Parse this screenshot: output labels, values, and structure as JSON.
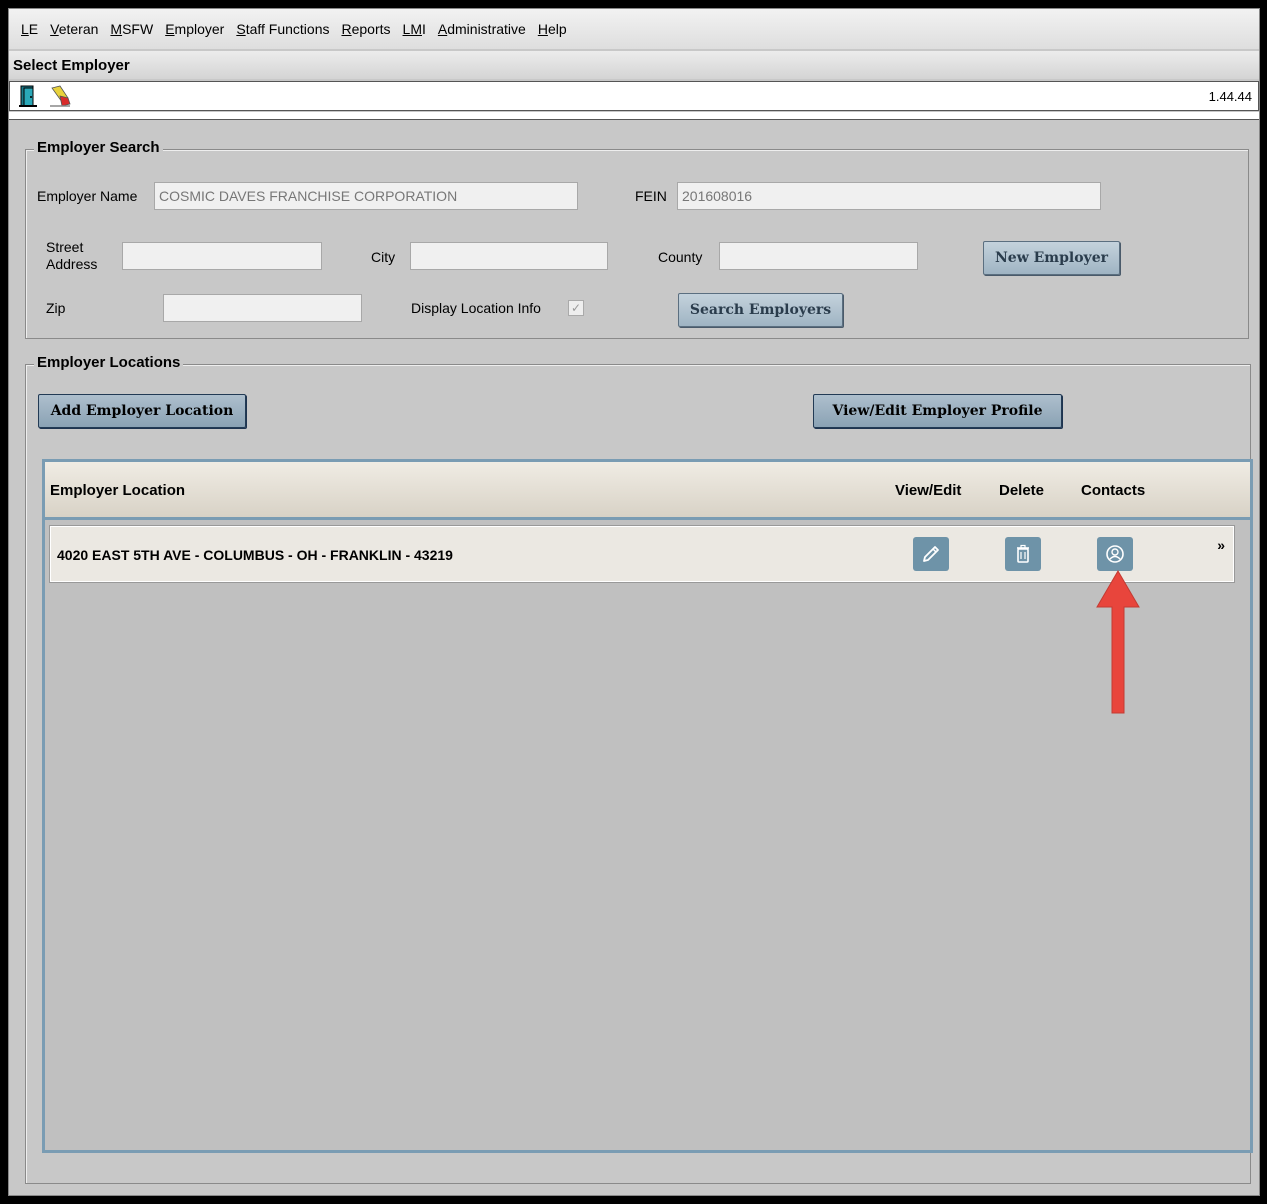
{
  "menu": [
    {
      "ul": "L",
      "rest": "E"
    },
    {
      "ul": "V",
      "rest": "eteran"
    },
    {
      "ul": "M",
      "rest": "SFW"
    },
    {
      "ul": "E",
      "rest": "mployer"
    },
    {
      "ul": "S",
      "rest": "taff Functions"
    },
    {
      "ul": "R",
      "rest": "eports"
    },
    {
      "ul": "LM",
      "rest": "I"
    },
    {
      "ul": "A",
      "rest": "dministrative"
    },
    {
      "ul": "H",
      "rest": "elp"
    }
  ],
  "window": {
    "title": "Select Employer",
    "version": "1.44.44"
  },
  "toolbar": {
    "icons": [
      "exit-door-icon",
      "eraser-clear-icon"
    ]
  },
  "search": {
    "legend": "Employer Search",
    "employer_name_label": "Employer Name",
    "employer_name_value": "COSMIC DAVES FRANCHISE CORPORATION",
    "fein_label": "FEIN",
    "fein_value": "201608016",
    "street_label_1": "Street",
    "street_label_2": "Address",
    "street_value": "",
    "city_label": "City",
    "city_value": "",
    "county_label": "County",
    "county_value": "",
    "zip_label": "Zip",
    "zip_value": "",
    "display_location_label": "Display Location Info",
    "display_location_checked": true,
    "new_employer_label": "New Employer",
    "search_employers_label": "Search Employers"
  },
  "locations": {
    "legend": "Employer Locations",
    "add_location_label": "Add Employer Location",
    "view_profile_label": "View/Edit Employer Profile",
    "columns": {
      "location": "Employer Location",
      "view_edit": "View/Edit",
      "delete": "Delete",
      "contacts": "Contacts"
    },
    "rows": [
      {
        "location": "4020 EAST 5TH AVE - COLUMBUS - OH - FRANKLIN - 43219",
        "more": "»"
      }
    ]
  },
  "annotation": {
    "arrow_color": "#e8453c",
    "target": "contacts-button"
  }
}
